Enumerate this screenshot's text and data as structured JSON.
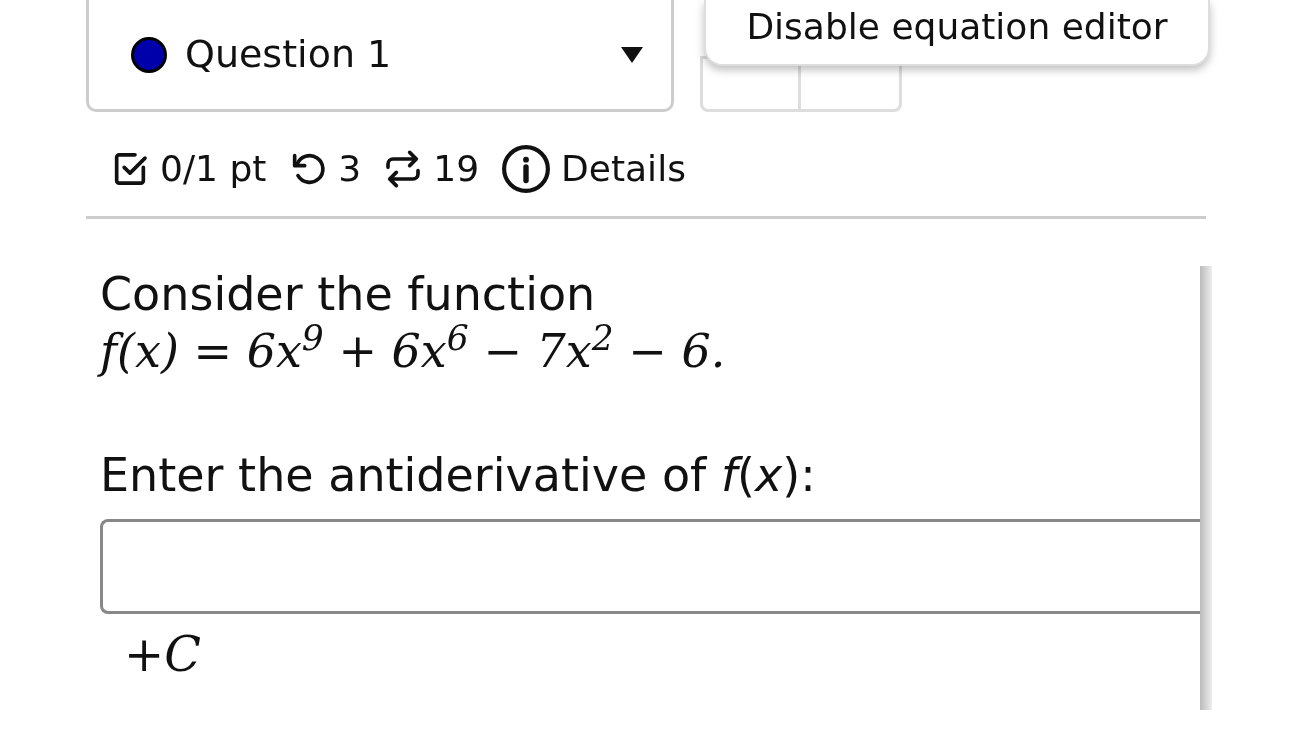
{
  "question_select": {
    "label": "Question 1"
  },
  "tooltip": {
    "text": "Disable equation editor"
  },
  "stats": {
    "score": "0/1 pt",
    "attempts": "3",
    "versions": "19",
    "details": "Details"
  },
  "question": {
    "intro": "Consider the function",
    "equation": "f(x) = 6x$^{9}$ + 6x$^{6}$ − 7x$^{2}$ − 6.",
    "prompt": "Enter the antiderivative of *f*(*x*):",
    "suffix": "+*C*"
  }
}
